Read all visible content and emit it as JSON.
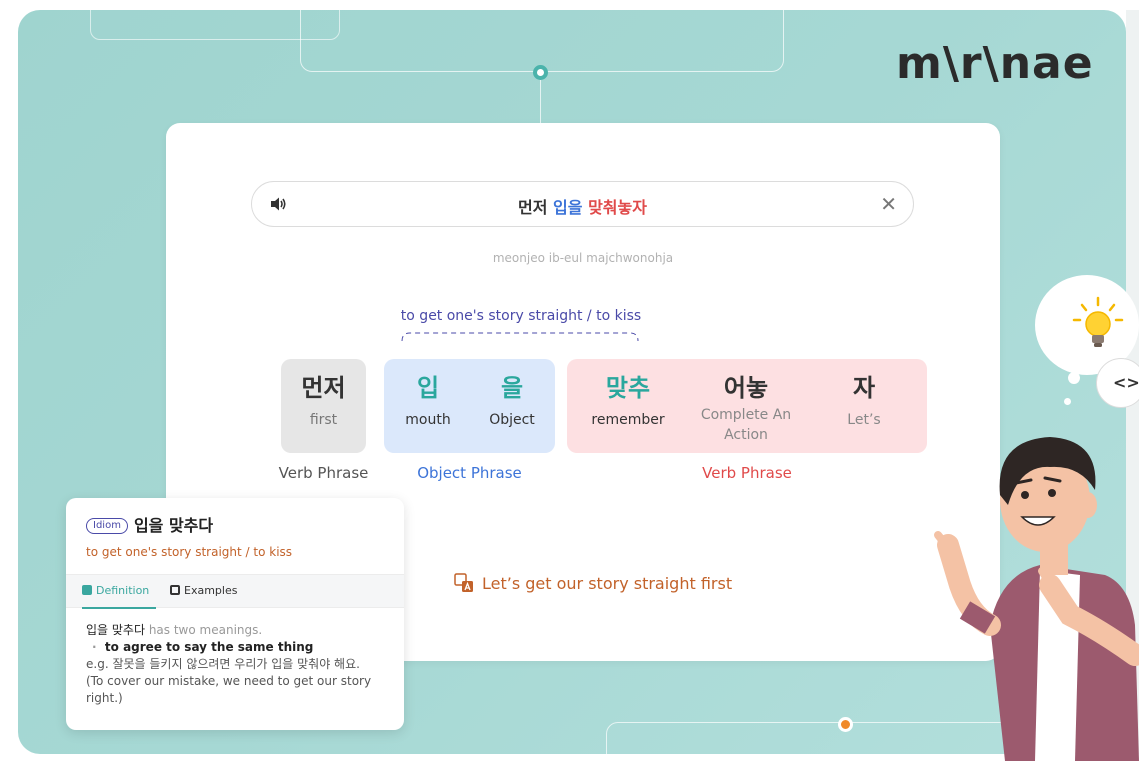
{
  "app": {
    "logo_text": "m\\r\\nae"
  },
  "sentence": {
    "word1": "먼저",
    "word2": "입을",
    "word3": "맞춰놓자",
    "romanization": "meonjeo ib-eul majchwonohja"
  },
  "breakdown": {
    "meaning_top": "to get one's story straight / to kiss",
    "tokens": [
      {
        "korean": "먼저",
        "english": "first"
      },
      {
        "korean": "입",
        "english": "mouth"
      },
      {
        "korean": "을",
        "english": "Object"
      },
      {
        "korean": "맞추",
        "english": "remember"
      },
      {
        "korean": "어놓",
        "english": "Complete An Action"
      },
      {
        "korean": "자",
        "english": "Let’s"
      }
    ],
    "phrases": [
      "Verb Phrase",
      "Object Phrase",
      "Verb Phrase"
    ]
  },
  "translation": "Let’s get our story straight first",
  "idiom": {
    "badge": "Idiom",
    "title": "입을 맞추다",
    "meaning": "to get one's story straight / to kiss",
    "tabs": {
      "definition": "Definition",
      "examples": "Examples"
    },
    "body": {
      "keyword": "입을 맞추다",
      "intro": " has two meanings.",
      "meaning1": "to agree to say the same thing",
      "bullet": "·",
      "example": "e.g. 잘못을 들키지 않으려면 우리가 입을 맞춰야 해요.",
      "example_translation": "(To cover our mistake, we need to get our story right.)"
    }
  },
  "colors": {
    "background": "#a6d8d4",
    "accent_teal": "#2aa79d",
    "object_blue": "#3d74d8",
    "verb_red": "#e04a4a",
    "translation_orange": "#c2622a"
  },
  "icons": [
    "speaker-icon",
    "close-icon",
    "translate-icon",
    "lightbulb-icon",
    "code-toggle-icon"
  ],
  "code_toggle_label": "<>"
}
